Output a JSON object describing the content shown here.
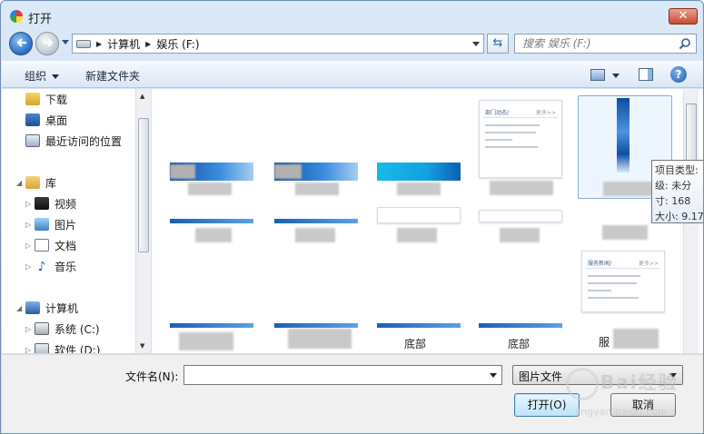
{
  "window": {
    "title": "打开",
    "close_label": "✕"
  },
  "nav": {
    "breadcrumbs": [
      "计算机",
      "娱乐 (F:)"
    ],
    "search_placeholder": "搜索 娱乐 (F:)"
  },
  "toolbar": {
    "organize_label": "组织",
    "new_folder_label": "新建文件夹",
    "help_label": "?"
  },
  "sidebar": {
    "items": [
      {
        "label": "下载",
        "icon": "download-folder-icon"
      },
      {
        "label": "桌面",
        "icon": "desktop-icon"
      },
      {
        "label": "最近访问的位置",
        "icon": "recent-places-icon"
      },
      {
        "label": "库",
        "icon": "library-icon"
      },
      {
        "label": "视频",
        "icon": "video-library-icon"
      },
      {
        "label": "图片",
        "icon": "pictures-library-icon"
      },
      {
        "label": "文档",
        "icon": "documents-library-icon"
      },
      {
        "label": "音乐",
        "icon": "music-library-icon"
      },
      {
        "label": "计算机",
        "icon": "computer-icon"
      },
      {
        "label": "系统 (C:)",
        "icon": "system-drive-icon"
      },
      {
        "label": "软件 (D:)",
        "icon": "drive-icon"
      }
    ]
  },
  "content": {
    "doc_thumb_1": {
      "title": "部门动态/",
      "more": "更多>>"
    },
    "doc_thumb_2": {
      "title": "服务新闻/",
      "more": "更多>>"
    },
    "tooltip": {
      "line1": "项目类型:",
      "line2": "级: 未分",
      "line3": "寸: 168",
      "line4": "大小: 9.17"
    },
    "partial_labels": [
      "底部",
      "底部",
      "服"
    ]
  },
  "bottom": {
    "filename_label": "文件名(N):",
    "filename_value": "",
    "filetype_value": "图片文件",
    "open_label": "打开(O)",
    "cancel_label": "取消"
  },
  "watermark": {
    "text": "Bai经验",
    "url": "jingyan.baidu.com"
  }
}
